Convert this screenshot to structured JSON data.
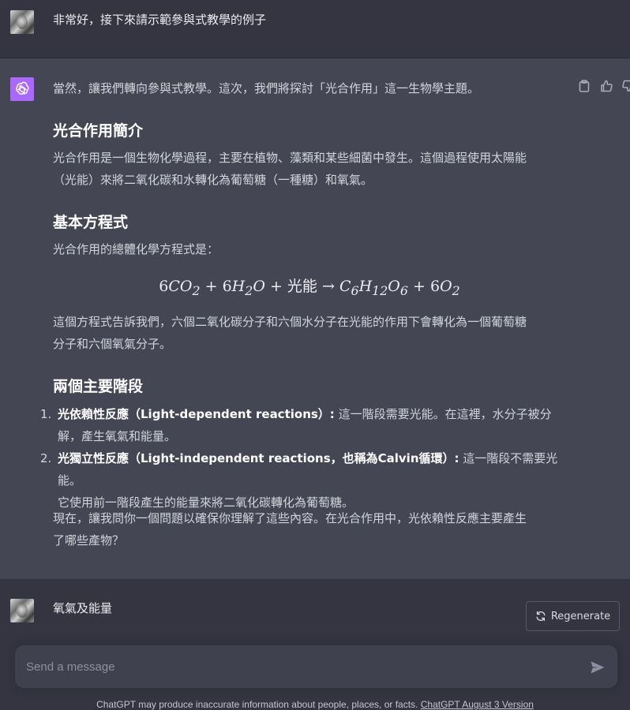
{
  "user_message_1": {
    "text": "非常好，接下來請示範參與式教學的例子"
  },
  "assistant_message": {
    "intro": "當然，讓我們轉向參與式教學。這次，我們將探討「光合作用」這一生物學主題。",
    "section1_title": "光合作用簡介",
    "section1_body_line1": "光合作用是一個生物化學過程，主要在植物、藻類和某些細菌中發生。這個過程使用太陽能",
    "section1_body_line2": "（光能）來將二氧化碳和水轉化為葡萄糖（一種糖）和氧氣。",
    "section2_title": "基本方程式",
    "section2_intro": "光合作用的總體化學方程式是：",
    "equation_light_energy": "光能",
    "section2_explain_line1": "這個方程式告訴我們，六個二氧化碳分子和六個水分子在光能的作用下會轉化為一個葡萄糖",
    "section2_explain_line2": "分子和六個氧氣分子。",
    "section3_title": "兩個主要階段",
    "stages": [
      {
        "num": "1.",
        "bold": "光依賴性反應（Light-dependent reactions）:",
        "text": " 這一階段需要光能。在這裡，水分子被分",
        "text2": "解，產生氧氣和能量。"
      },
      {
        "num": "2.",
        "bold": "光獨立性反應（Light-independent reactions，也稱為Calvin循環）:",
        "text": " 這一階段不需要光能。",
        "text2": "它使用前一階段產生的能量來將二氧化碳轉化為葡萄糖。"
      }
    ],
    "question_line1": "現在，讓我問你一個問題以確保你理解了這些內容。在光合作用中，光依賴性反應主要產生",
    "question_line2": "了哪些產物？"
  },
  "user_message_2": {
    "text": "氧氣及能量"
  },
  "regenerate_button": {
    "label": "Regenerate"
  },
  "composer": {
    "placeholder": "Send a message"
  },
  "footer": {
    "text": "ChatGPT may produce inaccurate information about people, places, or facts. ",
    "link": "ChatGPT August 3 Version"
  },
  "icons": {
    "copy": "clipboard-icon",
    "thumbs_up": "thumbs-up-icon",
    "thumbs_down": "thumbs-down-icon",
    "regenerate": "refresh-icon",
    "send": "send-icon"
  },
  "colors": {
    "assistant_avatar": "#ab68ff",
    "assistant_bg": "#444654",
    "user_bg": "#343541"
  }
}
